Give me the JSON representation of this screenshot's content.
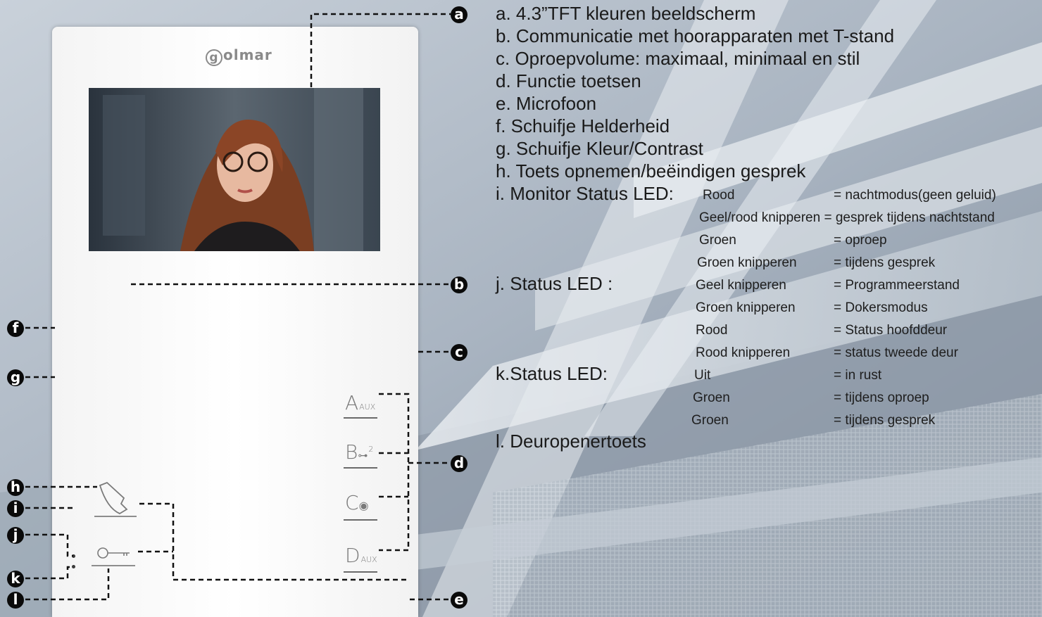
{
  "brand": {
    "logo_text": "olmar",
    "logo_letter": "g"
  },
  "labels": {
    "a": "a. 4.3”TFT kleuren beeldscherm",
    "b": "b. Communicatie met hoorapparaten met T-stand",
    "c": "c. Oproepvolume: maximaal, minimaal en stil",
    "d": "d. Functie toetsen",
    "e": "e. Microfoon",
    "f": "f.  Schuifje Helderheid",
    "g": "g. Schuifje Kleur/Contrast",
    "h": "h. Toets opnemen/beëindigen gesprek",
    "i": "i. Monitor Status LED:",
    "j": "j. Status LED :",
    "k": "k.Status LED:",
    "l": "l. Deuropenertoets"
  },
  "status_i": [
    {
      "state": "Rood",
      "meaning": "= nachtmodus(geen geluid)"
    },
    {
      "state": "Geel/rood knipperen = gesprek tijdens nachtstand",
      "meaning": ""
    },
    {
      "state": "Groen",
      "meaning": "= oproep"
    }
  ],
  "status_j": [
    {
      "state": "Groen knipperen",
      "meaning": "= tijdens gesprek"
    },
    {
      "state": "Geel  knipperen",
      "meaning": "= Programmeerstand"
    },
    {
      "state": "Groen knipperen",
      "meaning": "= Dokersmodus"
    },
    {
      "state": "Rood",
      "meaning": "= Status hoofddeur"
    },
    {
      "state": "Rood knipperen",
      "meaning": "= status tweede deur"
    }
  ],
  "status_k": [
    {
      "state": "Uit",
      "meaning": "= in rust"
    },
    {
      "state": "Groen",
      "meaning": "= tijdens oproep"
    },
    {
      "state": "Groen",
      "meaning": "= tijdens gesprek"
    }
  ],
  "markers": {
    "a": "a",
    "b": "b",
    "c": "c",
    "d": "d",
    "e": "e",
    "f": "f",
    "g": "g",
    "h": "h",
    "i": "i",
    "j": "j",
    "k": "k",
    "l": "l"
  },
  "buttons": {
    "A": {
      "letter": "A",
      "sub": "AUX"
    },
    "B": {
      "letter": "B",
      "sub": "2"
    },
    "C": {
      "letter": "C"
    },
    "D": {
      "letter": "D",
      "sub": "AUX"
    }
  },
  "colors": {
    "background": "#aab4c0",
    "monitor": "#f7f7f7",
    "marker": "#0a0a0a"
  }
}
